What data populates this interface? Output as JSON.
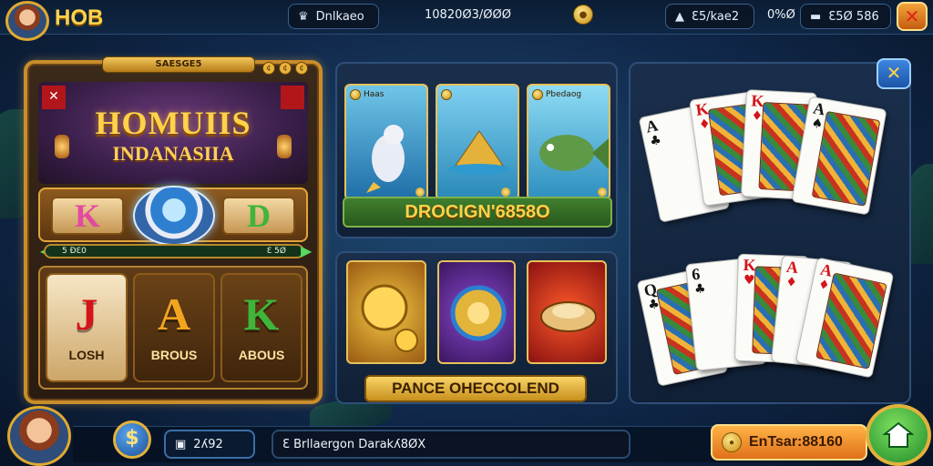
{
  "header": {
    "brand": "HOB",
    "title_label": "Dnlkaeo",
    "balance": "10820Ø3/ØØØ",
    "bet": "Ɛ5/kae2",
    "count": "0%Ø",
    "credits": "Ɛ5Ø 586",
    "close_label": "✕"
  },
  "slot": {
    "header_label": "SAESGE5",
    "corner_label": "✕",
    "logo_line1": "HOMUIIS",
    "logo_line2": "INDANASIIA",
    "win_letters": [
      "K",
      "D"
    ],
    "win_bar_left": "5 ÐƐ0",
    "win_bar_right": "Ɛ 5Ø",
    "reels": [
      {
        "symbol": "J",
        "label": "LOSH"
      },
      {
        "symbol": "A",
        "label": "BROUS"
      },
      {
        "symbol": "K",
        "label": "ABOUS"
      }
    ]
  },
  "fishing": {
    "cards": [
      {
        "tag": "Haas"
      },
      {
        "tag": ""
      },
      {
        "tag": "Pbedaog"
      }
    ],
    "banner": "DROCIGN'6858O"
  },
  "treasure": {
    "banner": "PANCE OHECCOLEND"
  },
  "cards_panel": {
    "close_label": "✕",
    "top_row": [
      {
        "rank": "A",
        "suit": "♣",
        "color": "black",
        "face": false
      },
      {
        "rank": "K",
        "suit": "♦",
        "color": "red",
        "face": true
      },
      {
        "rank": "K",
        "suit": "♦",
        "color": "red",
        "face": true
      },
      {
        "rank": "A",
        "suit": "♠",
        "color": "black",
        "face": true
      }
    ],
    "bottom_row": [
      {
        "rank": "Q",
        "suit": "♣",
        "color": "black",
        "face": true
      },
      {
        "rank": "6",
        "suit": "♣",
        "color": "black",
        "face": false
      },
      {
        "rank": "K",
        "suit": "♥",
        "color": "red",
        "face": true
      },
      {
        "rank": "A",
        "suit": "♦",
        "color": "red",
        "face": false
      },
      {
        "rank": "A",
        "suit": "♦",
        "color": "red",
        "face": true
      }
    ]
  },
  "footer": {
    "dollar_label": "$",
    "ticket_value": "2ʎ92",
    "message": "Ɛ Brllaergon Darakʎ8ØX",
    "enter_label": "EnTsar:88160"
  }
}
